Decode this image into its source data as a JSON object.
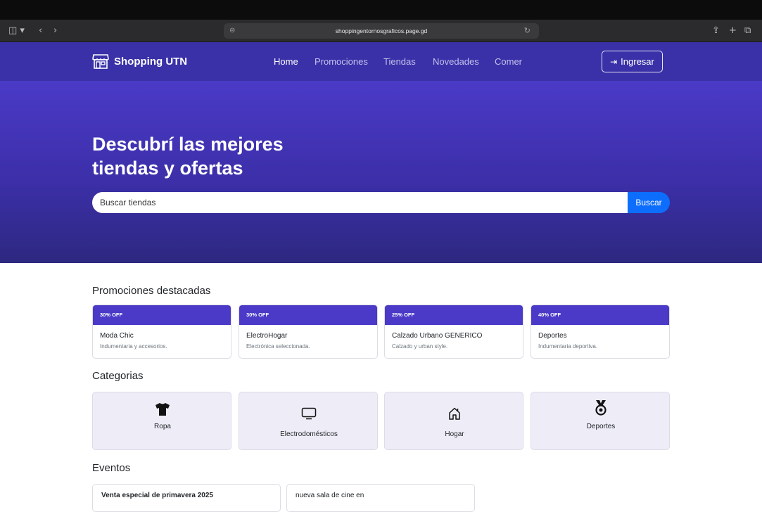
{
  "browser": {
    "url": "shoppingentornosgraficos.page.gd"
  },
  "navbar": {
    "brand": "Shopping UTN",
    "links": [
      "Home",
      "Promociones",
      "Tiendas",
      "Novedades",
      "Comer"
    ],
    "login_label": "Ingresar"
  },
  "hero": {
    "title_line1": "Descubrí las mejores",
    "title_line2": "tiendas y ofertas",
    "search_placeholder": "Buscar tiendas",
    "search_button": "Buscar"
  },
  "promotions": {
    "title": "Promociones destacadas",
    "items": [
      {
        "badge": "30% OFF",
        "name": "Moda Chic",
        "desc": "Indumentaria y accesorios."
      },
      {
        "badge": "30% OFF",
        "name": "ElectroHogar",
        "desc": "Electrónica seleccionada."
      },
      {
        "badge": "25% OFF",
        "name": "Calzado Urbano GENERICO",
        "desc": "Calzado y urban style."
      },
      {
        "badge": "40% OFF",
        "name": "Deportes",
        "desc": "Indumentaria deportiva."
      }
    ]
  },
  "categories": {
    "title": "Categorias",
    "items": [
      {
        "label": "Ropa",
        "icon": "shirt-icon"
      },
      {
        "label": "Electrodomésticos",
        "icon": "tv-icon"
      },
      {
        "label": "Hogar",
        "icon": "house-icon"
      },
      {
        "label": "Deportes",
        "icon": "medal-icon"
      }
    ]
  },
  "events": {
    "title": "Eventos",
    "items": [
      {
        "title": "Venta especial de primavera 2025"
      },
      {
        "title": "nueva sala de cine en"
      }
    ]
  },
  "colors": {
    "navbar": "#3a31a8",
    "hero": "#4a3ac7",
    "accent_button": "#0d6efd",
    "category_bg": "#eeedf7"
  }
}
